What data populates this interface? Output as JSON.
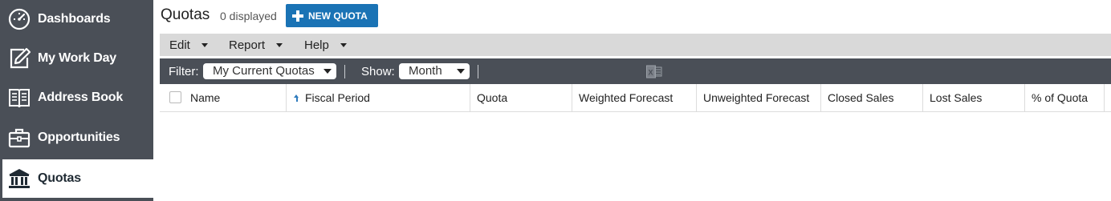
{
  "sidebar": {
    "items": [
      {
        "label": "Dashboards",
        "icon": "gauge-icon"
      },
      {
        "label": "My Work Day",
        "icon": "edit-icon"
      },
      {
        "label": "Address Book",
        "icon": "address-book-icon"
      },
      {
        "label": "Opportunities",
        "icon": "briefcase-icon"
      },
      {
        "label": "Quotas",
        "icon": "bank-icon",
        "active": true
      }
    ]
  },
  "header": {
    "title": "Quotas",
    "count": "0 displayed",
    "new_button": "NEW QUOTA"
  },
  "menu": {
    "items": [
      "Edit",
      "Report",
      "Help"
    ]
  },
  "filterbar": {
    "filter_label": "Filter:",
    "filter_value": "My Current Quotas",
    "show_label": "Show:",
    "show_value": "Month"
  },
  "grid": {
    "columns": [
      "Name",
      "Fiscal Period",
      "Quota",
      "Weighted Forecast",
      "Unweighted Forecast",
      "Closed Sales",
      "Lost Sales",
      "% of Quota"
    ],
    "sorted_column": "Fiscal Period",
    "sort_direction": "ascending",
    "rows": []
  },
  "colors": {
    "sidebar_bg": "#4a4f57",
    "accent": "#1a73b5",
    "menubar_bg": "#d9d9d9"
  }
}
